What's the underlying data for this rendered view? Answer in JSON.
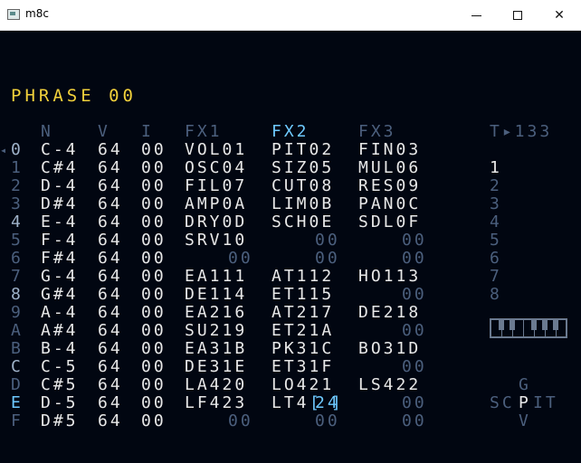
{
  "window": {
    "title": "m8c",
    "minimize": "—",
    "maximize": "□",
    "close": "✕"
  },
  "phrase": {
    "title": "PHRASE 00"
  },
  "headers": {
    "n": "N",
    "v": "V",
    "i": "I",
    "fx1": "FX1",
    "fx2": "FX2",
    "fx3": "FX3"
  },
  "tempo": "T▸133",
  "play_marker": "◂",
  "rows": [
    {
      "num": "0",
      "note": "C-4",
      "vol": "64",
      "inst": "00",
      "fx1": "VOL01",
      "fx2": "PIT02",
      "fx3": "FIN03"
    },
    {
      "num": "1",
      "note": "C#4",
      "vol": "64",
      "inst": "00",
      "fx1": "OSC04",
      "fx2": "SIZ05",
      "fx3": "MUL06"
    },
    {
      "num": "2",
      "note": "D-4",
      "vol": "64",
      "inst": "00",
      "fx1": "FIL07",
      "fx2": "CUT08",
      "fx3": "RES09"
    },
    {
      "num": "3",
      "note": "D#4",
      "vol": "64",
      "inst": "00",
      "fx1": "AMP0A",
      "fx2": "LIM0B",
      "fx3": "PAN0C"
    },
    {
      "num": "4",
      "note": "E-4",
      "vol": "64",
      "inst": "00",
      "fx1": "DRY0D",
      "fx2": "SCH0E",
      "fx3": "SDL0F"
    },
    {
      "num": "5",
      "note": "F-4",
      "vol": "64",
      "inst": "00",
      "fx1": "SRV10",
      "fx2": "00",
      "fx3": "00"
    },
    {
      "num": "6",
      "note": "F#4",
      "vol": "64",
      "inst": "00",
      "fx1": "00",
      "fx2": "00",
      "fx3": "00"
    },
    {
      "num": "7",
      "note": "G-4",
      "vol": "64",
      "inst": "00",
      "fx1": "EA111",
      "fx2": "AT112",
      "fx3": "HO113"
    },
    {
      "num": "8",
      "note": "G#4",
      "vol": "64",
      "inst": "00",
      "fx1": "DE114",
      "fx2": "ET115",
      "fx3": "00"
    },
    {
      "num": "9",
      "note": "A-4",
      "vol": "64",
      "inst": "00",
      "fx1": "EA216",
      "fx2": "AT217",
      "fx3": "DE218"
    },
    {
      "num": "A",
      "note": "A#4",
      "vol": "64",
      "inst": "00",
      "fx1": "SU219",
      "fx2": "ET21A",
      "fx3": "00"
    },
    {
      "num": "B",
      "note": "B-4",
      "vol": "64",
      "inst": "00",
      "fx1": "EA31B",
      "fx2": "PK31C",
      "fx3": "BO31D"
    },
    {
      "num": "C",
      "note": "C-5",
      "vol": "64",
      "inst": "00",
      "fx1": "DE31E",
      "fx2": "ET31F",
      "fx3": "00"
    },
    {
      "num": "D",
      "note": "C#5",
      "vol": "64",
      "inst": "00",
      "fx1": "LA420",
      "fx2": "LO421",
      "fx3": "LS422"
    },
    {
      "num": "E",
      "note": "D-5",
      "vol": "64",
      "inst": "00",
      "fx1": "LF423",
      "fx2": "LT424",
      "fx3": "00"
    },
    {
      "num": "F",
      "note": "D#5",
      "vol": "64",
      "inst": "00",
      "fx1": "00",
      "fx2": "00",
      "fx3": "00"
    }
  ],
  "fx2_cursor": {
    "prefix": "LT4",
    "value": "24"
  },
  "track_list": [
    "1",
    "2",
    "3",
    "4",
    "5",
    "6",
    "7",
    "8"
  ],
  "nav_map": {
    "top": "G",
    "left": "SC",
    "center": "P",
    "right": "IT",
    "bottom": "V"
  },
  "colors": {
    "background": "#010611",
    "title": "#f2d13b",
    "text": "#e8e8e8",
    "dim": "#4b5f7d",
    "accent": "#6ec9ff"
  }
}
